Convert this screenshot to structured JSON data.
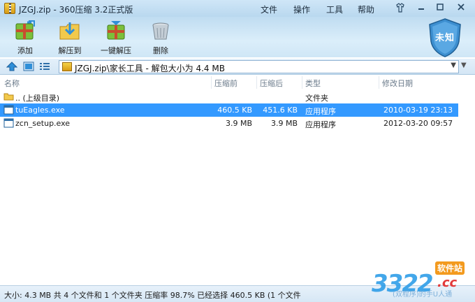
{
  "window": {
    "title": "JZGJ.zip - 360压缩 3.2正式版",
    "menus": [
      "文件",
      "操作",
      "工具",
      "帮助"
    ]
  },
  "toolbar": {
    "add_label": "添加",
    "extract_to_label": "解压到",
    "one_click_extract_label": "一键解压",
    "delete_label": "删除"
  },
  "security": {
    "status_label": "未知"
  },
  "address": {
    "path": "JZGJ.zip\\家长工具 - 解包大小为 4.4 MB"
  },
  "columns": {
    "name": "名称",
    "compressed": "压缩前",
    "after": "压缩后",
    "type": "类型",
    "modified": "修改日期"
  },
  "files": [
    {
      "name": ".. (上级目录)",
      "compressed": "",
      "after": "",
      "type": "文件夹",
      "modified": ""
    },
    {
      "name": "tuEagles.exe",
      "compressed": "460.5 KB",
      "after": "451.6 KB",
      "type": "应用程序",
      "modified": "2010-03-19 23:13"
    },
    {
      "name": "zcn_setup.exe",
      "compressed": "3.9 MB",
      "after": "3.9 MB",
      "type": "应用程序",
      "modified": "2012-03-20 09:57"
    }
  ],
  "status": {
    "text": "大小: 4.3 MB 共 4 个文件和 1 个文件夹 压缩率 98.7% 已经选择 460.5 KB (1 个文件"
  },
  "watermark": {
    "number": "3322",
    "tag": "软件站",
    "suffix": ".cc",
    "subtitle": "(双程序)的手U人通"
  },
  "colors": {
    "selection": "#3399ff",
    "chrome": "#cfe6f7",
    "shield": "#3d8fd0"
  }
}
